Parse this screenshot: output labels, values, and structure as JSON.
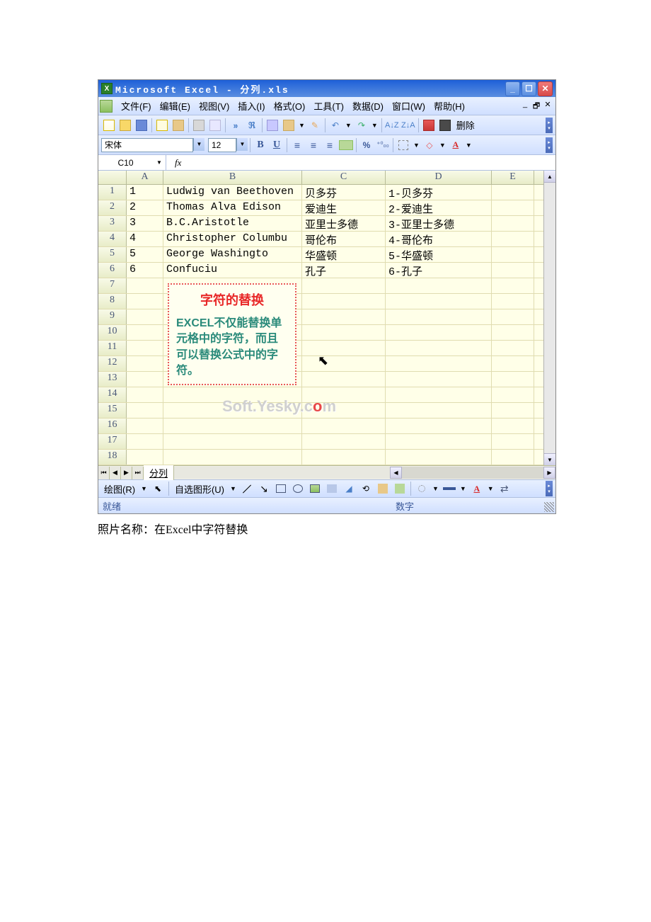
{
  "title_bar": {
    "text": "Microsoft Excel - 分列.xls"
  },
  "menu": {
    "file": "文件(F)",
    "edit": "编辑(E)",
    "view": "视图(V)",
    "insert": "插入(I)",
    "format": "格式(O)",
    "tools": "工具(T)",
    "data": "数据(D)",
    "window": "窗口(W)",
    "help": "帮助(H)"
  },
  "standard_toolbar": {
    "delete_text": "删除"
  },
  "formatting_toolbar": {
    "font_name": "宋体",
    "font_size": "12"
  },
  "formula_bar": {
    "name_box": "C10",
    "fx": "fx",
    "formula": ""
  },
  "columns": [
    "A",
    "B",
    "C",
    "D",
    "E"
  ],
  "rows": [
    {
      "n": "1",
      "a": "1",
      "b": "Ludwig van Beethoven",
      "c": "贝多芬",
      "d": "1-贝多芬"
    },
    {
      "n": "2",
      "a": "2",
      "b": "Thomas Alva Edison",
      "c": "爱迪生",
      "d": "2-爱迪生"
    },
    {
      "n": "3",
      "a": "3",
      "b": "B.C.Aristotle",
      "c": "亚里士多德",
      "d": "3-亚里士多德"
    },
    {
      "n": "4",
      "a": "4",
      "b": "Christopher Columbu",
      "c": "哥伦布",
      "d": "4-哥伦布"
    },
    {
      "n": "5",
      "a": "5",
      "b": "George Washingto",
      "c": "华盛顿",
      "d": "5-华盛顿"
    },
    {
      "n": "6",
      "a": "6",
      "b": "Confuciu",
      "c": "孔子",
      "d": "6-孔子"
    },
    {
      "n": "7"
    },
    {
      "n": "8"
    },
    {
      "n": "9"
    },
    {
      "n": "10"
    },
    {
      "n": "11"
    },
    {
      "n": "12"
    },
    {
      "n": "13"
    },
    {
      "n": "14"
    },
    {
      "n": "15"
    },
    {
      "n": "16"
    },
    {
      "n": "17"
    },
    {
      "n": "18"
    }
  ],
  "annotation": {
    "title": "字符的替换",
    "body": "EXCEL不仅能替换单元格中的字符，而且可以替换公式中的字符。"
  },
  "watermark": {
    "prefix": "Soft.Yesky.c",
    "o": "o",
    "suffix": "m"
  },
  "sheet_tabs": {
    "active": "分列"
  },
  "drawing_bar": {
    "draw": "绘图(R)",
    "autoshapes": "自选图形(U)"
  },
  "status_bar": {
    "left": "就绪",
    "right": "数字"
  },
  "caption": "照片名称：在Excel中字符替换"
}
